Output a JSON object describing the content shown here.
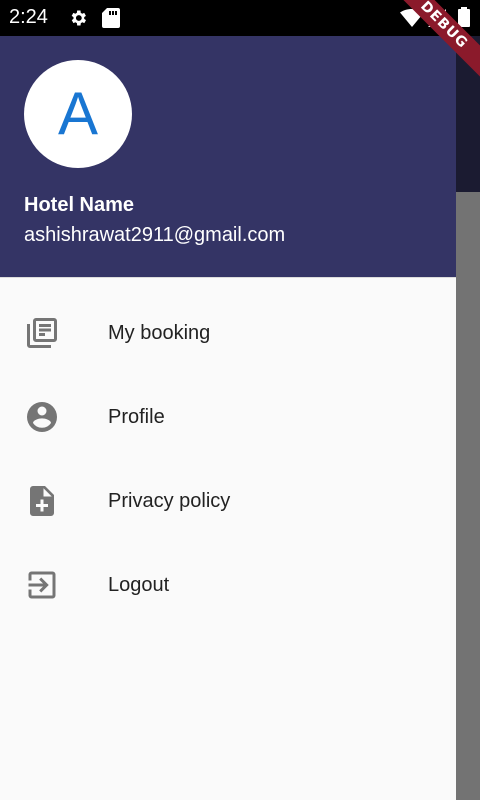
{
  "status_bar": {
    "time": "2:24",
    "icons": [
      "settings-icon",
      "sd-card-icon",
      "wifi-icon",
      "signal-icon",
      "battery-icon"
    ]
  },
  "debug_banner": "DEBUG",
  "drawer": {
    "header": {
      "avatar_letter": "A",
      "name": "Hotel Name",
      "email": "ashishrawat2911@gmail.com"
    },
    "items": [
      {
        "label": "My booking",
        "icon": "library-books-icon"
      },
      {
        "label": "Profile",
        "icon": "account-circle-icon"
      },
      {
        "label": "Privacy policy",
        "icon": "note-add-icon"
      },
      {
        "label": "Logout",
        "icon": "exit-to-app-icon"
      }
    ]
  },
  "colors": {
    "header": "#343465",
    "drawer_bg": "#fafafa",
    "avatar_letter": "#1976d2",
    "icon": "#757575",
    "debug_ribbon": "#8b1a2b"
  }
}
